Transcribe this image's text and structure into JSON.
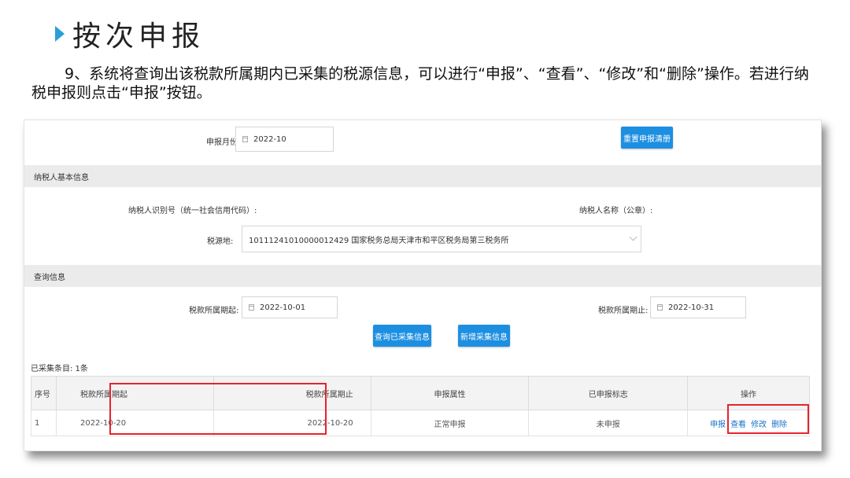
{
  "slide": {
    "title": "按次申报",
    "intro": "9、系统将查询出该税款所属期内已采集的税源信息，可以进行“申报”、“查看”、“修改”和“删除”操作。若进行纳税申报则点击“申报”按钮。"
  },
  "form": {
    "period_label": "申报月份:",
    "period_value": "2022-10",
    "reset_button": "重置申报清册",
    "section_basic": "纳税人基本信息",
    "taxpayer_id_label": "纳税人识别号（统一社会信用代码）:",
    "taxpayer_name_label": "纳税人名称（公章）:",
    "source_label": "税源地:",
    "source_value": "10111241010000012429 国家税务总局天津市和平区税务局第三税务所",
    "section_query": "查询信息",
    "start_label": "税款所属期起:",
    "start_value": "2022-10-01",
    "end_label": "税款所属期止:",
    "end_value": "2022-10-31",
    "query_button": "查询已采集信息",
    "add_button": "新增采集信息",
    "count_text": "已采集条目: 1条"
  },
  "table": {
    "headers": [
      "序号",
      "税款所属期起",
      "税款所属期止",
      "申报属性",
      "已申报标志",
      "操作"
    ],
    "rows": [
      {
        "index": "1",
        "start": "2022-10-20",
        "end": "2022-10-20",
        "attr": "正常申报",
        "status": "未申报",
        "actions": [
          "申报",
          "查看",
          "修改",
          "删除"
        ]
      }
    ]
  },
  "colors": {
    "accent": "#1d8fe1",
    "highlight": "#e8232a",
    "status_pending": "#f0a030",
    "title_marker": "#2a9fd8"
  }
}
